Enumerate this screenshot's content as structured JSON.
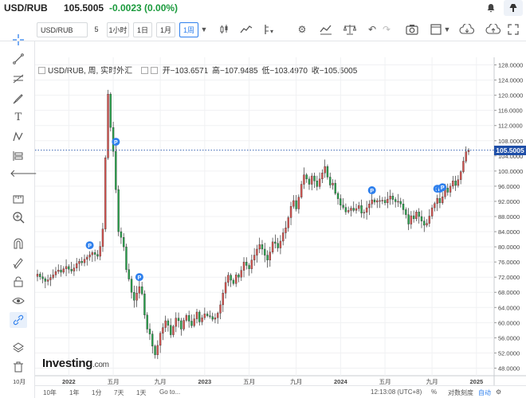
{
  "header": {
    "symbol": "USD/RUB",
    "price": "105.5005",
    "change": "-0.0023 (0.00%)",
    "colors": {
      "change": "#1a9a3c",
      "accent": "#2f80ed",
      "up": "#d9534f",
      "down": "#27a34b"
    }
  },
  "toolbar": {
    "symbol_input": "USD/RUB",
    "intervals": [
      "5",
      "1小时",
      "1日",
      "1月",
      "1周"
    ],
    "active_interval": "1周",
    "icons": [
      "candles-icon",
      "line-chart-icon",
      "compare-icon",
      "settings-icon",
      "indicators-icon",
      "scale-icon",
      "undo-icon",
      "redo-icon",
      "camera-icon",
      "layout-icon",
      "cloud-download-icon",
      "cloud-upload-icon"
    ]
  },
  "legend": {
    "title": "USD/RUB, 周, 实时外汇",
    "open": "开−103.6571",
    "high": "高−107.9485",
    "low": "低−103.4970",
    "close": "收−105.5005"
  },
  "chart_data": {
    "type": "candlestick",
    "title": "USD/RUB, 周, 实时外汇",
    "xlabel": "",
    "ylabel": "",
    "ylim": [
      46,
      130
    ],
    "y_ticks": [
      "48.0000",
      "52.0000",
      "56.0000",
      "60.0000",
      "64.0000",
      "68.0000",
      "72.0000",
      "76.0000",
      "80.0000",
      "84.0000",
      "88.0000",
      "92.0000",
      "96.0000",
      "100.0000",
      "104.0000",
      "108.0000",
      "112.0000",
      "116.0000",
      "120.0000",
      "124.0000",
      "128.0000"
    ],
    "x_ticks": [
      "10月",
      "2022",
      "五月",
      "九月",
      "2023",
      "五月",
      "九月",
      "2024",
      "五月",
      "九月",
      "2025"
    ],
    "last_price": "105.5005",
    "marker_label": "P",
    "markers_week_index": [
      20,
      30,
      39,
      128,
      153,
      154,
      155
    ],
    "grid": true,
    "close_series": [
      72.8,
      72.1,
      71.6,
      70.9,
      71.3,
      71.9,
      72.6,
      73.5,
      73.9,
      73.3,
      74.2,
      74.8,
      74.1,
      73.6,
      74.4,
      75.6,
      76.2,
      75.8,
      76.7,
      77.3,
      77.9,
      78.5,
      78.0,
      77.5,
      80.1,
      84.7,
      103.5,
      120.3,
      111.5,
      105.2,
      95.1,
      84.0,
      82.5,
      80.0,
      74.0,
      71.5,
      68.0,
      65.9,
      67.8,
      69.5,
      67.6,
      62.0,
      58.3,
      57.0,
      53.8,
      51.5,
      54.0,
      57.2,
      58.7,
      60.5,
      59.3,
      56.8,
      59.0,
      61.2,
      60.5,
      58.3,
      60.6,
      61.9,
      60.4,
      59.2,
      61.0,
      62.8,
      60.2,
      61.3,
      62.3,
      61.8,
      61.6,
      60.9,
      61.3,
      62.5,
      64.7,
      67.8,
      70.6,
      72.5,
      71.2,
      70.3,
      72.6,
      72.0,
      73.8,
      76.0,
      75.1,
      74.2,
      76.5,
      77.8,
      79.4,
      80.6,
      79.4,
      77.8,
      76.5,
      78.6,
      81.3,
      80.9,
      79.7,
      81.5,
      83.7,
      85.0,
      87.7,
      90.7,
      92.2,
      90.0,
      93.1,
      96.5,
      99.0,
      97.9,
      96.5,
      98.7,
      97.4,
      95.9,
      97.9,
      99.5,
      101.2,
      98.4,
      96.3,
      96.8,
      94.1,
      92.7,
      91.0,
      90.4,
      89.2,
      89.6,
      90.2,
      89.6,
      90.1,
      90.9,
      88.9,
      89.1,
      90.3,
      91.3,
      92.4,
      91.8,
      92.2,
      92.2,
      92.3,
      91.6,
      92.6,
      93.4,
      92.5,
      91.9,
      92.0,
      91.3,
      89.8,
      88.5,
      86.0,
      88.2,
      87.4,
      89.2,
      88.0,
      86.8,
      85.7,
      86.2,
      88.1,
      90.3,
      91.4,
      92.8,
      91.6,
      93.2,
      95.5,
      94.4,
      96.0,
      97.4,
      96.2,
      97.7,
      99.8,
      102.6,
      105.1,
      105.5005
    ]
  },
  "price_tag": "105.5005",
  "logo": {
    "name": "Investing",
    "suffix": ".com"
  },
  "bottombar": {
    "ranges": [
      "10年",
      "1年",
      "1分",
      "7天",
      "1天"
    ],
    "goto": "Go to...",
    "time": "12:13:08 (UTC+8)",
    "percent": "%",
    "log": "对数刻度",
    "auto": "自动"
  }
}
